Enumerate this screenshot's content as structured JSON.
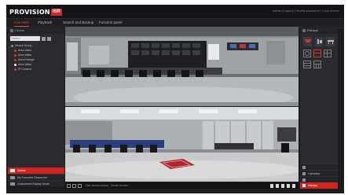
{
  "app": {
    "logo_text": "PROVISION",
    "logo_badge": "ISR",
    "user_info": "admin (Logout) | Modify password | Lock screen"
  },
  "nav": {
    "tabs": [
      {
        "label": "Live view",
        "active": true
      },
      {
        "label": "Playback",
        "active": false
      },
      {
        "label": "Search and Backup",
        "active": false
      },
      {
        "label": "Function panel",
        "active": false
      }
    ]
  },
  "left_panel": {
    "title": "Device",
    "search_placeholder": "Search",
    "tree": [
      {
        "label": "Device Group",
        "level": 0,
        "status": "grey"
      },
      {
        "label": "Area Video",
        "level": 1,
        "status": "red"
      },
      {
        "label": "Area Video",
        "level": 1,
        "status": "red"
      },
      {
        "label": "Area Fisheye",
        "level": 1,
        "status": "red"
      },
      {
        "label": "Area Video",
        "level": 1,
        "status": "white"
      },
      {
        "label": "IP Camera",
        "level": 1,
        "status": "red"
      }
    ],
    "bottom_menu": [
      {
        "label": "Device",
        "active": true
      },
      {
        "label": "My Favourite Resources",
        "active": false
      },
      {
        "label": "Customized Display Mode",
        "active": false
      }
    ]
  },
  "bottom_toolbar": {
    "status_text": "Main stream window - Stream window"
  },
  "right_panel": {
    "title": "Fisheye",
    "bottom_menu": [
      {
        "label": "",
        "active": false
      },
      {
        "label": "Operation",
        "active": false
      },
      {
        "label": "",
        "active": false
      },
      {
        "label": "Fisheye",
        "active": true
      }
    ]
  },
  "colors": {
    "accent": "#d2241f",
    "background": "#1b1c1f",
    "panel": "#2a2b2f"
  }
}
